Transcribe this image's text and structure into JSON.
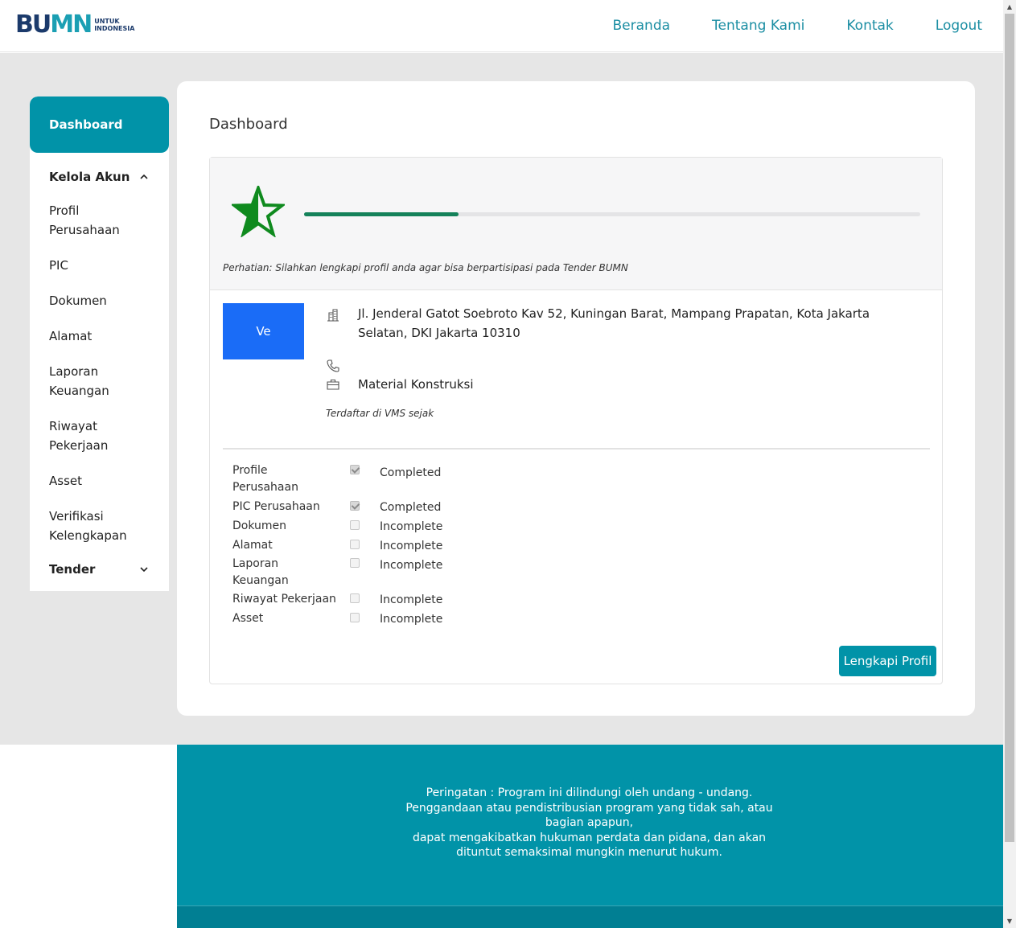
{
  "brand": {
    "logo_text_a": "BU",
    "logo_text_b": "MN",
    "logo_sub_1": "UNTUK",
    "logo_sub_2": "INDONESIA",
    "accent_color": "#0193a8",
    "link_color": "#1b8ea3",
    "progress_color": "#15825a",
    "avatar_color": "#1a6cf7",
    "star_color": "#0f8a1e"
  },
  "nav": {
    "items": [
      "Beranda",
      "Tentang Kami",
      "Kontak",
      "Logout"
    ]
  },
  "sidebar": {
    "active": "Dashboard",
    "group_1": {
      "label": "Kelola Akun",
      "icon": "chevron-up-icon"
    },
    "items": [
      "Profil Perusahaan",
      "PIC",
      "Dokumen",
      "Alamat",
      "Laporan Keuangan",
      "Riwayat Pekerjaan",
      "Asset",
      "Verifikasi Kelengkapan"
    ],
    "group_2": {
      "label": "Tender",
      "icon": "chevron-down-icon"
    }
  },
  "main": {
    "title": "Dashboard",
    "profile_progress": 0.25,
    "star_icon": "half-star-icon",
    "notice": "Perhatian: Silahkan lengkapi profil anda agar bisa berpartisipasi pada Tender BUMN",
    "avatar_text": "Ve",
    "address": "Jl. Jenderal Gatot Soebroto Kav 52, Kuningan Barat, Mampang Prapatan, Kota Jakarta Selatan, DKI Jakarta 10310",
    "address_icon": "building-icon",
    "phone": "",
    "phone_icon": "phone-icon",
    "category": "Material Konstruksi",
    "category_icon": "briefcase-icon",
    "registered": "Terdaftar di VMS sejak",
    "status": [
      {
        "label": "Profile Perusahaan",
        "checked": true,
        "value": "Completed"
      },
      {
        "label": "PIC Perusahaan",
        "checked": true,
        "value": "Completed"
      },
      {
        "label": "Dokumen",
        "checked": false,
        "value": "Incomplete"
      },
      {
        "label": "Alamat",
        "checked": false,
        "value": "Incomplete"
      },
      {
        "label": "Laporan Keuangan",
        "checked": false,
        "value": "Incomplete"
      },
      {
        "label": "Riwayat Pekerjaan",
        "checked": false,
        "value": "Incomplete"
      },
      {
        "label": "Asset",
        "checked": false,
        "value": "Incomplete"
      }
    ],
    "button_label": "Lengkapi Profil"
  },
  "footer": {
    "line_1": "Peringatan : Program ini dilindungi oleh undang - undang.",
    "line_2": "Penggandaan atau pendistribusian program yang tidak sah, atau bagian apapun,",
    "line_3": "dapat mengakibatkan hukuman perdata dan pidana, dan akan dituntut semaksimal mungkin menurut hukum."
  }
}
